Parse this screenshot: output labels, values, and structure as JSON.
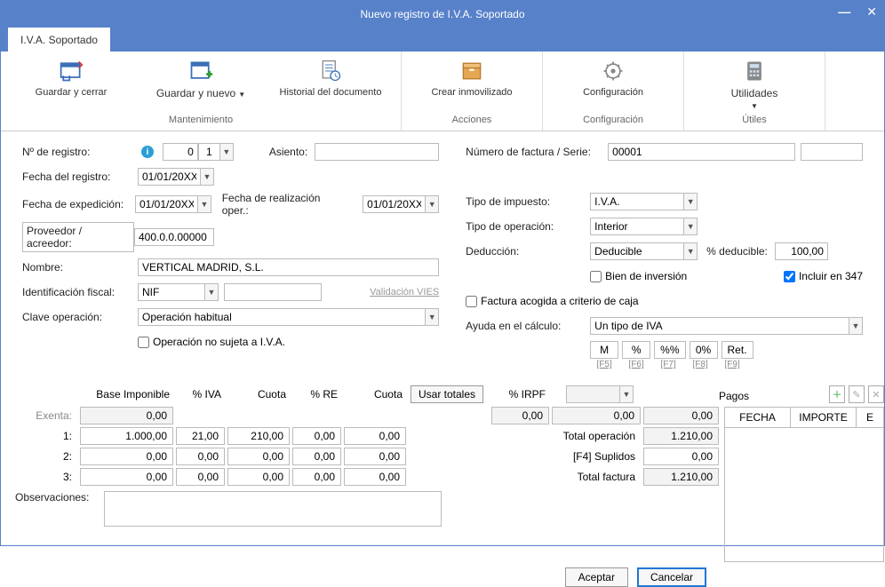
{
  "window": {
    "title": "Nuevo registro de I.V.A. Soportado"
  },
  "tab": "I.V.A. Soportado",
  "ribbon": {
    "groups": [
      {
        "name": "Mantenimiento",
        "items": [
          {
            "label": "Guardar y cerrar",
            "dd": false
          },
          {
            "label": "Guardar y nuevo",
            "dd": true
          },
          {
            "label": "Historial del documento",
            "dd": false
          }
        ]
      },
      {
        "name": "Acciones",
        "items": [
          {
            "label": "Crear inmovilizado",
            "dd": false
          }
        ]
      },
      {
        "name": "Configuración",
        "items": [
          {
            "label": "Configuración",
            "dd": false
          }
        ]
      },
      {
        "name": "Útiles",
        "items": [
          {
            "label": "Utilidades",
            "dd": true
          }
        ]
      }
    ]
  },
  "left": {
    "numRegistroLabel": "Nº de registro:",
    "numRegistroA": "0",
    "numRegistroB": "1",
    "asientoLabel": "Asiento:",
    "asiento": "",
    "fechaRegistroLabel": "Fecha del registro:",
    "fechaRegistro": "01/01/20XX",
    "fechaExpedicionLabel": "Fecha de expedición:",
    "fechaExpedicion": "01/01/20XX",
    "fechaRealizLabel": "Fecha de realización oper.:",
    "fechaRealiz": "01/01/20XX",
    "proveedorLabel": "Proveedor / acreedor:",
    "proveedor": "400.0.0.00000",
    "nombreLabel": "Nombre:",
    "nombre": "VERTICAL MADRID, S.L.",
    "idFiscalLabel": "Identificación fiscal:",
    "idFiscalTipo": "NIF",
    "idFiscalNum": "",
    "validacionVies": "Validación VIES",
    "claveOpLabel": "Clave operación:",
    "claveOp": "Operación habitual",
    "noSujeta": "Operación no sujeta a I.V.A."
  },
  "right": {
    "numFacturaLabel": "Número de factura / Serie:",
    "numFactura": "00001",
    "numSerie": "",
    "tipoImpuestoLabel": "Tipo de impuesto:",
    "tipoImpuesto": "I.V.A.",
    "tipoOperacionLabel": "Tipo de operación:",
    "tipoOperacion": "Interior",
    "deduccionLabel": "Deducción:",
    "deduccion": "Deducible",
    "pctDeducibleLabel": "% deducible:",
    "pctDeducible": "100,00",
    "bienInversion": "Bien de inversión",
    "incluir347": "Incluir en 347",
    "criterioCaja": "Factura acogida a criterio de caja",
    "ayudaCalculoLabel": "Ayuda en el cálculo:",
    "ayudaCalculo": "Un tipo de IVA",
    "calcBtns": [
      {
        "t": "M",
        "fk": "[F5]"
      },
      {
        "t": "%",
        "fk": "[F6]"
      },
      {
        "t": "%%",
        "fk": "[F7]"
      },
      {
        "t": "0%",
        "fk": "[F8]"
      },
      {
        "t": "Ret.",
        "fk": "[F9]"
      }
    ]
  },
  "table": {
    "headers": {
      "base": "Base Imponible",
      "pctIva": "% IVA",
      "cuota1": "Cuota",
      "pctRe": "% RE",
      "cuota2": "Cuota",
      "usarTotales": "Usar totales",
      "pctIrpf": "% IRPF"
    },
    "rows": [
      {
        "name": "Exenta:",
        "base": "0,00",
        "pctIva": "",
        "cuota1": "",
        "pctRe": "",
        "cuota2": "",
        "irpf1": "0,00",
        "irpf2": "0,00",
        "irpf3": "0,00",
        "readonly": true
      },
      {
        "name": "1:",
        "base": "1.000,00",
        "pctIva": "21,00",
        "cuota1": "210,00",
        "pctRe": "0,00",
        "cuota2": "0,00",
        "readonly": false
      },
      {
        "name": "2:",
        "base": "0,00",
        "pctIva": "0,00",
        "cuota1": "0,00",
        "pctRe": "0,00",
        "cuota2": "0,00",
        "readonly": false
      },
      {
        "name": "3:",
        "base": "0,00",
        "pctIva": "0,00",
        "cuota1": "0,00",
        "pctRe": "0,00",
        "cuota2": "0,00",
        "readonly": false
      }
    ],
    "totals": {
      "totalOpLabel": "Total operación",
      "totalOp": "1.210,00",
      "suplidosLabel": "[F4] Suplidos",
      "suplidos": "0,00",
      "totalFacturaLabel": "Total factura",
      "totalFactura": "1.210,00"
    }
  },
  "pagos": {
    "title": "Pagos",
    "col1": "FECHA",
    "col2": "IMPORTE",
    "col3": "E"
  },
  "obsLabel": "Observaciones:",
  "obs": "",
  "buttons": {
    "aceptar": "Aceptar",
    "cancelar": "Cancelar"
  }
}
